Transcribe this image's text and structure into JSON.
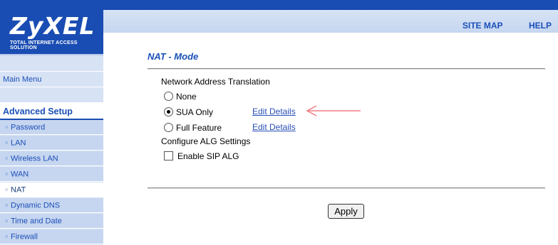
{
  "brand": {
    "logo": "ZyXEL",
    "tagline": "Total Internet Access Solution"
  },
  "top_links": {
    "site_map": "SITE MAP",
    "help": "HELP"
  },
  "sidebar": {
    "main_menu": "Main Menu",
    "section": "Advanced Setup",
    "items": [
      {
        "label": "Password",
        "active": false
      },
      {
        "label": "LAN",
        "active": false
      },
      {
        "label": "Wireless LAN",
        "active": false
      },
      {
        "label": "WAN",
        "active": false
      },
      {
        "label": "NAT",
        "active": true
      },
      {
        "label": "Dynamic DNS",
        "active": false
      },
      {
        "label": "Time and Date",
        "active": false
      },
      {
        "label": "Firewall",
        "active": false
      }
    ]
  },
  "page": {
    "title": "NAT - Mode",
    "nat_label": "Network Address Translation",
    "options": [
      {
        "label": "None",
        "selected": false
      },
      {
        "label": "SUA Only",
        "selected": true
      },
      {
        "label": "Full Feature",
        "selected": false
      }
    ],
    "edit_link": "Edit Details",
    "alg_label": "Configure ALG Settings",
    "sip_alg": {
      "label": "Enable SIP ALG",
      "checked": false
    },
    "apply": "Apply"
  },
  "colors": {
    "brand_blue": "#1a4db3",
    "sidebar_bg": "#d7e3f5",
    "link": "#2a4fb7",
    "annotation_arrow": "#f07d82"
  }
}
